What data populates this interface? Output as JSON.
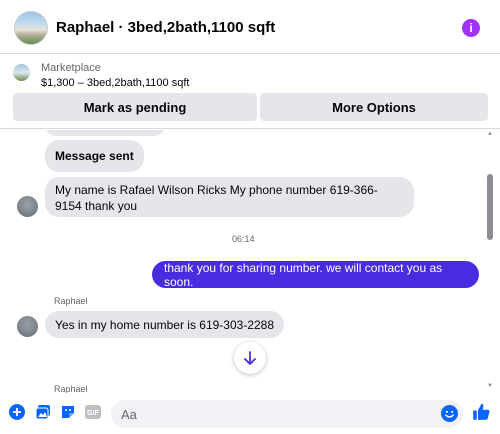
{
  "header": {
    "title": "Raphael · 3bed,2bath,1100 sqft",
    "info_icon": "info-icon"
  },
  "listing": {
    "source": "Marketplace",
    "price_line": "$1,300 – 3bed,2bath,1100 sqft",
    "buttons": {
      "pending": "Mark as pending",
      "more": "More Options"
    }
  },
  "messages": [
    {
      "from": "them",
      "text": "Message sent"
    },
    {
      "from": "them",
      "text": "My name is Rafael Wilson Ricks My phone number 619-366-9154 thank you"
    },
    {
      "from": "meta",
      "text": "06:14"
    },
    {
      "from": "me",
      "text": "thank you for sharing number. we will contact you as soon."
    },
    {
      "from": "sender",
      "text": "Raphael"
    },
    {
      "from": "them",
      "text": "Yes in my home number is 619-303-2288"
    },
    {
      "from": "sender",
      "text": "Raphael"
    }
  ],
  "composer": {
    "placeholder": "Aa",
    "icons": [
      "plus-circle-icon",
      "photo-icon",
      "sticker-icon",
      "gif-icon",
      "emoji-icon",
      "thumbs-up-icon"
    ]
  },
  "colors": {
    "accent": "#0866ff",
    "outgoing_bubble": "#4a2ce0",
    "incoming_bubble": "#e4e6eb",
    "info": "#a033ff"
  }
}
